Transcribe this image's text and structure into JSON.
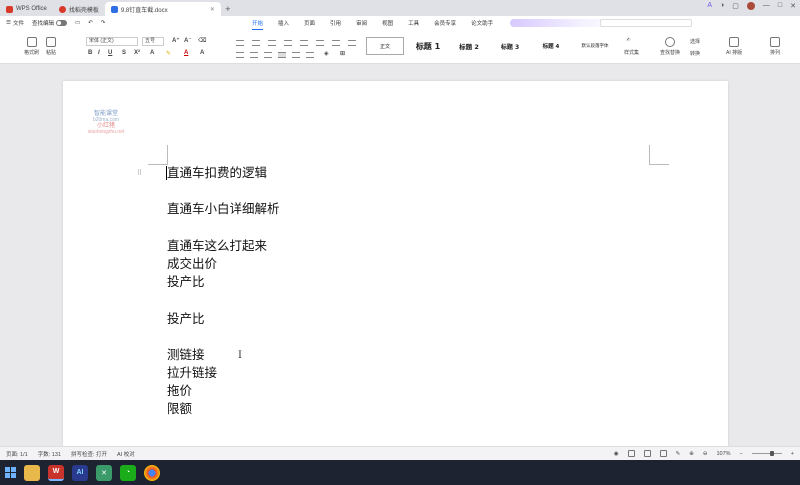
{
  "tabs": [
    {
      "label": "WPS Office",
      "color": "#d8392b",
      "active": false
    },
    {
      "label": "找稻壳模板",
      "color": "#d8392b",
      "active": false
    },
    {
      "label": "9.8钉直车截.docx",
      "color": "#2f6fe4",
      "active": true
    }
  ],
  "menu": {
    "file_label": "文件",
    "collab_label": "查找编辑",
    "tabs": [
      "开始",
      "插入",
      "页面",
      "引用",
      "审阅",
      "视图",
      "工具",
      "会员专享",
      "论文助手"
    ],
    "active_tab": "开始"
  },
  "ribbon": {
    "format_painter": "格式刷",
    "paste": "粘贴",
    "font_name": "宋体 (正文)",
    "font_size": "五号",
    "styles": {
      "normal": "正文",
      "h1": "标题 1",
      "h2": "标题 2",
      "h3": "标题 3",
      "h4": "标题 4",
      "more": "默认段落字体"
    },
    "style_set": "样式集",
    "find_replace": "查找替换",
    "select": "选择",
    "ai_layout": "AI 排版",
    "arrange": "排列",
    "convert": "转换"
  },
  "watermark": {
    "line1": "智能课堂",
    "line2": "b20ma.com",
    "line3": "小红猪",
    "line4": "xiaohongzhu.net"
  },
  "document": {
    "lines": [
      "直通车扣费的逻辑",
      "",
      "直通车小白详细解析",
      "",
      "直通车这么打起来",
      "成交出价",
      "投产比",
      "",
      "投产比",
      "",
      "测链接",
      "拉升链接",
      "拖价",
      "限额"
    ],
    "cursor_glyph": "I"
  },
  "status": {
    "page": "页面: 1/1",
    "words": "字数: 131",
    "spell": "拼写检查: 打开",
    "ai": "AI 校对",
    "zoom": "107%"
  },
  "taskbar": {
    "ai_label": "AI"
  }
}
